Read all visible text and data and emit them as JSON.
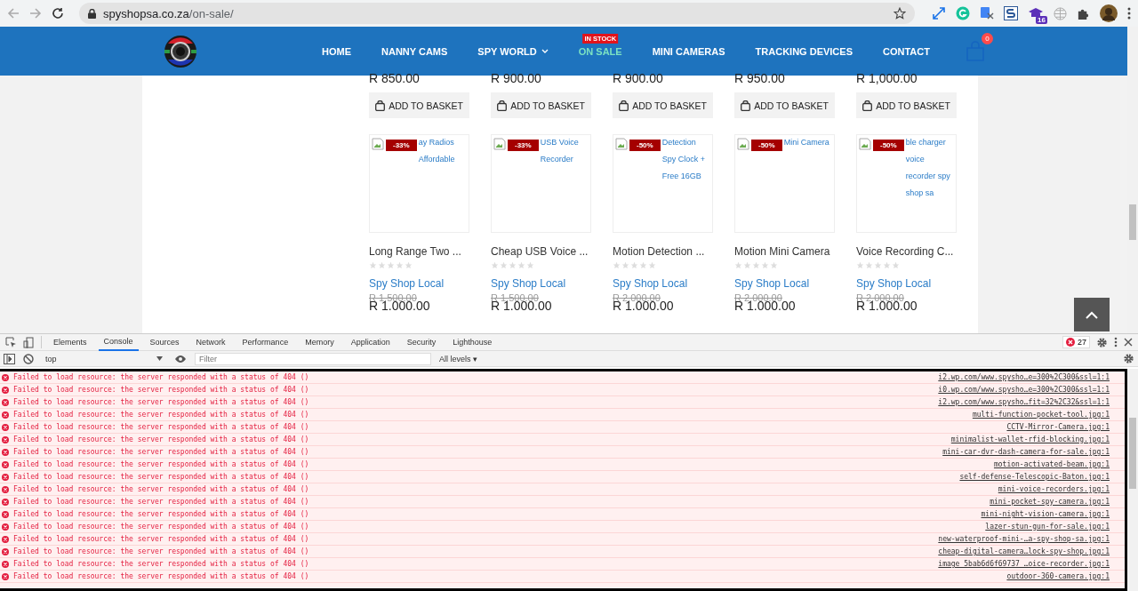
{
  "browser": {
    "url_host": "spyshopsa.co.za",
    "url_path": "/on-sale/",
    "extension_badge": "16"
  },
  "nav": {
    "items": [
      {
        "label": "HOME",
        "selected": false,
        "dropdown": false
      },
      {
        "label": "NANNY CAMS",
        "selected": false,
        "dropdown": false
      },
      {
        "label": "SPY WORLD",
        "selected": false,
        "dropdown": true
      },
      {
        "label": "ON SALE",
        "selected": true,
        "dropdown": false,
        "badge": "IN STOCK"
      },
      {
        "label": "MINI CAMERAS",
        "selected": false,
        "dropdown": false
      },
      {
        "label": "TRACKING DEVICES",
        "selected": false,
        "dropdown": false
      },
      {
        "label": "CONTACT",
        "selected": false,
        "dropdown": false
      }
    ],
    "cart_count": "0"
  },
  "top_row": [
    {
      "price": "R 850.00",
      "button": "ADD TO BASKET"
    },
    {
      "price": "R 900.00",
      "button": "ADD TO BASKET"
    },
    {
      "price": "R 900.00",
      "button": "ADD TO BASKET"
    },
    {
      "price": "R 950.00",
      "button": "ADD TO BASKET"
    },
    {
      "price": "R 1,000.00",
      "button": "ADD TO BASKET"
    }
  ],
  "products": [
    {
      "alt": "ay Radios Affordable",
      "discount": "-33%",
      "title": "Long Range Two ...",
      "stars": 0,
      "store": "Spy Shop Local",
      "old_price": "R 1,500.00",
      "price": "R 1.000.00"
    },
    {
      "alt": "USB Voice Recorder",
      "discount": "-33%",
      "title": "Cheap USB Voice ...",
      "stars": 0,
      "store": "Spy Shop Local",
      "old_price": "R 1,500.00",
      "price": "R 1.000.00"
    },
    {
      "alt": "Detection Spy Clock + Free 16GB",
      "discount": "-50%",
      "title": "Motion Detection ...",
      "stars": 0,
      "store": "Spy Shop Local",
      "old_price": "R 2,000.00",
      "price": "R 1.000.00"
    },
    {
      "alt": "Mini Camera",
      "discount": "-50%",
      "title": "Motion Mini Camera",
      "stars": 0,
      "store": "Spy Shop Local",
      "old_price": "R 2,000.00",
      "price": "R 1.000.00"
    },
    {
      "alt": "ble charger voice recorder spy shop sa",
      "discount": "-50%",
      "title": "Voice Recording C...",
      "stars": 0,
      "store": "Spy Shop Local",
      "old_price": "R 2,000.00",
      "price": "R 1.000.00"
    }
  ],
  "devtools": {
    "tabs": [
      {
        "label": "Elements",
        "selected": false
      },
      {
        "label": "Console",
        "selected": true
      },
      {
        "label": "Sources",
        "selected": false
      },
      {
        "label": "Network",
        "selected": false
      },
      {
        "label": "Performance",
        "selected": false
      },
      {
        "label": "Memory",
        "selected": false
      },
      {
        "label": "Application",
        "selected": false
      },
      {
        "label": "Security",
        "selected": false
      },
      {
        "label": "Lighthouse",
        "selected": false
      }
    ],
    "error_count": "27",
    "context": "top",
    "filter_placeholder": "Filter",
    "levels": "All levels ▾",
    "messages": [
      {
        "text": "Failed to load resource: the server responded with a status of 404 ()",
        "source": "i2.wp.com/www.spysho…e=300%2C300&ssl=1:1"
      },
      {
        "text": "Failed to load resource: the server responded with a status of 404 ()",
        "source": "i0.wp.com/www.spysho…e=300%2C300&ssl=1:1"
      },
      {
        "text": "Failed to load resource: the server responded with a status of 404 ()",
        "source": "i2.wp.com/www.spysho…fit=32%2C32&ssl=1:1"
      },
      {
        "text": "Failed to load resource: the server responded with a status of 404 ()",
        "source": "multi-function-pocket-tool.jpg:1"
      },
      {
        "text": "Failed to load resource: the server responded with a status of 404 ()",
        "source": "CCTV-Mirror-Camera.jpg:1"
      },
      {
        "text": "Failed to load resource: the server responded with a status of 404 ()",
        "source": "minimalist-wallet-rfid-blocking.jpg:1"
      },
      {
        "text": "Failed to load resource: the server responded with a status of 404 ()",
        "source": "mini-car-dvr-dash-camera-for-sale.jpg:1"
      },
      {
        "text": "Failed to load resource: the server responded with a status of 404 ()",
        "source": "motion-activated-beam.jpg:1"
      },
      {
        "text": "Failed to load resource: the server responded with a status of 404 ()",
        "source": "self-defense-Telescopic-Baton.jpg:1"
      },
      {
        "text": "Failed to load resource: the server responded with a status of 404 ()",
        "source": "mini-voice-recorders.jpg:1"
      },
      {
        "text": "Failed to load resource: the server responded with a status of 404 ()",
        "source": "mini-pocket-spy-camera.jpg:1"
      },
      {
        "text": "Failed to load resource: the server responded with a status of 404 ()",
        "source": "mini-night-vision-camera.jpg:1"
      },
      {
        "text": "Failed to load resource: the server responded with a status of 404 ()",
        "source": "lazer-stun-gun-for-sale.jpg:1"
      },
      {
        "text": "Failed to load resource: the server responded with a status of 404 ()",
        "source": "new-waterproof-mini-…a-spy-shop-sa.jpg:1"
      },
      {
        "text": "Failed to load resource: the server responded with a status of 404 ()",
        "source": "cheap-digital-camera…lock-spy-shop.jpg:1"
      },
      {
        "text": "Failed to load resource: the server responded with a status of 404 ()",
        "source": "image_5bab6d6f69737_…oice-recorder.jpg:1"
      },
      {
        "text": "Failed to load resource: the server responded with a status of 404 ()",
        "source": "outdoor-360-camera.jpg:1"
      }
    ]
  }
}
